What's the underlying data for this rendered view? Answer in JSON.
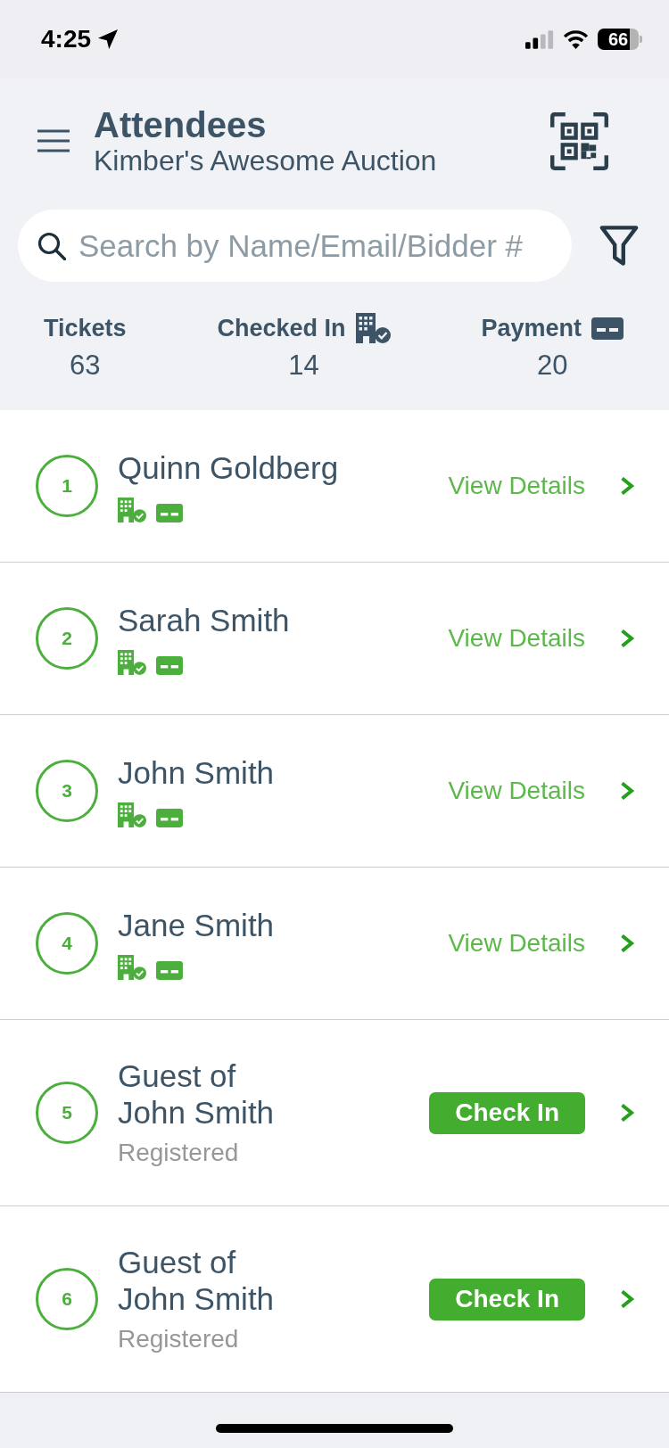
{
  "status_bar": {
    "time": "4:25",
    "battery": "66"
  },
  "header": {
    "title": "Attendees",
    "subtitle": "Kimber's Awesome Auction"
  },
  "search": {
    "placeholder": "Search by Name/Email/Bidder #"
  },
  "stats": [
    {
      "label": "Tickets",
      "value": "63",
      "kind": "count"
    },
    {
      "label": "Checked In",
      "value": "14",
      "kind": "checked-in"
    },
    {
      "label": "Payment",
      "value": "20",
      "kind": "payment"
    }
  ],
  "attendees": [
    {
      "number": "1",
      "name": "Quinn Goldberg",
      "checked_in": true,
      "paid": true,
      "action": {
        "kind": "link",
        "label": "View Details"
      }
    },
    {
      "number": "2",
      "name": "Sarah Smith",
      "checked_in": true,
      "paid": true,
      "action": {
        "kind": "link",
        "label": "View Details"
      }
    },
    {
      "number": "3",
      "name": "John Smith",
      "checked_in": true,
      "paid": true,
      "action": {
        "kind": "link",
        "label": "View Details"
      }
    },
    {
      "number": "4",
      "name": "Jane Smith",
      "checked_in": true,
      "paid": true,
      "action": {
        "kind": "link",
        "label": "View Details"
      }
    },
    {
      "number": "5",
      "name": "Guest of\nJohn Smith",
      "status": "Registered",
      "checked_in": false,
      "paid": false,
      "action": {
        "kind": "button",
        "label": "Check In"
      }
    },
    {
      "number": "6",
      "name": "Guest of\nJohn Smith",
      "status": "Registered",
      "checked_in": false,
      "paid": false,
      "action": {
        "kind": "button",
        "label": "Check In"
      }
    }
  ]
}
